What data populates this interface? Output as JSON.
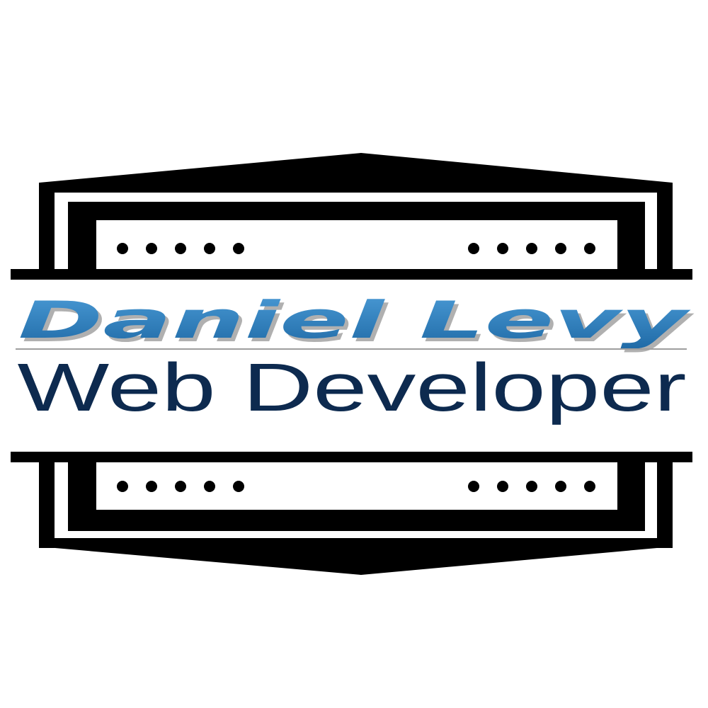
{
  "logo": {
    "name": "Daniel Levy",
    "role": "Web Developer"
  },
  "colors": {
    "frame": "#000000",
    "background": "#ffffff",
    "name": "#2a7ab8",
    "name_shadow": "#8f8f8f",
    "role": "#0d2a4f",
    "rule": "#9e9e9e"
  }
}
